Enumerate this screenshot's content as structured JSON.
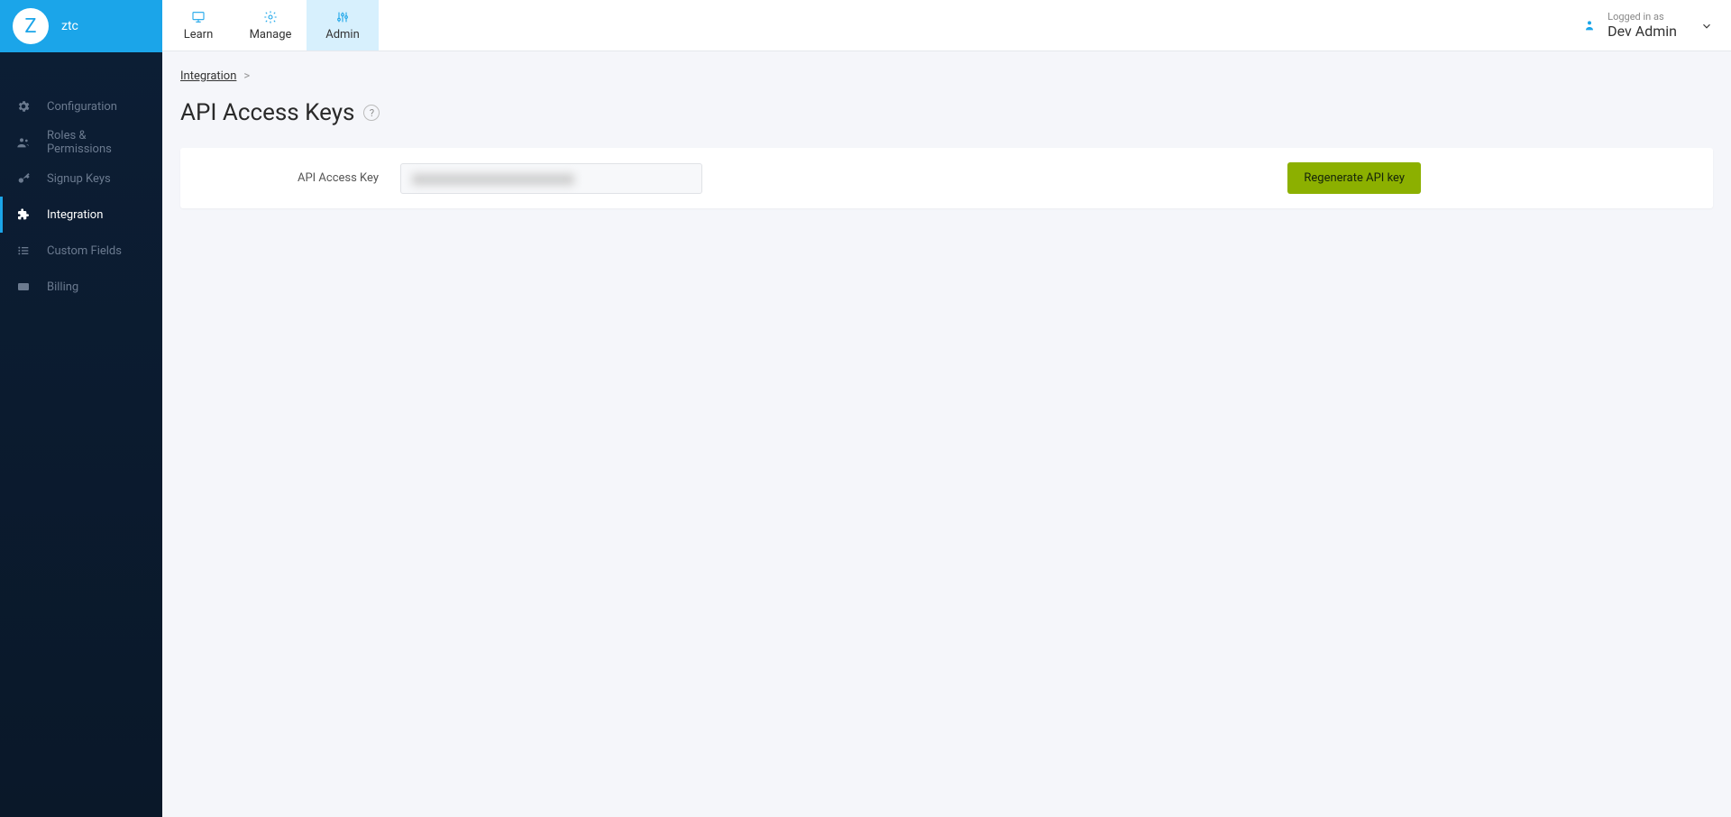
{
  "org": {
    "avatar_letter": "Z",
    "name": "ztc"
  },
  "sidebar": {
    "items": [
      {
        "label": "Configuration",
        "icon": "gear-icon",
        "active": false
      },
      {
        "label": "Roles & Permissions",
        "icon": "users-icon",
        "active": false
      },
      {
        "label": "Signup Keys",
        "icon": "key-icon",
        "active": false
      },
      {
        "label": "Integration",
        "icon": "puzzle-icon",
        "active": true
      },
      {
        "label": "Custom Fields",
        "icon": "list-icon",
        "active": false
      },
      {
        "label": "Billing",
        "icon": "card-icon",
        "active": false
      }
    ]
  },
  "top_tabs": [
    {
      "label": "Learn",
      "icon": "monitor-icon",
      "active": false
    },
    {
      "label": "Manage",
      "icon": "cog-icon",
      "active": false
    },
    {
      "label": "Admin",
      "icon": "sliders-icon",
      "active": true
    }
  ],
  "user": {
    "prefix": "Logged in as",
    "name": "Dev Admin"
  },
  "breadcrumb": {
    "link": "Integration",
    "sep": ">"
  },
  "page": {
    "title": "API Access Keys",
    "help": "?"
  },
  "panel": {
    "field_label": "API Access Key",
    "button_label": "Regenerate API key"
  }
}
